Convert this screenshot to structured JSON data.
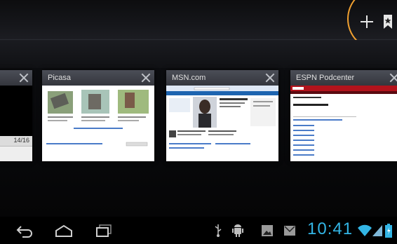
{
  "toolbar": {
    "new_tab_icon": "plus-icon",
    "bookmarks_icon": "bookmark-icon"
  },
  "tabs": [
    {
      "title": "",
      "page_number": "14/16"
    },
    {
      "title": "Picasa"
    },
    {
      "title": "MSN.com"
    },
    {
      "title": "ESPN Podcenter"
    }
  ],
  "status": {
    "time": "10:41",
    "icons": [
      "usb-icon",
      "android-debug-icon",
      "image-icon",
      "mail-icon",
      "wifi-icon",
      "signal-icon",
      "battery-icon"
    ]
  },
  "colors": {
    "accent": "#33b5e5",
    "highlight_ring": "#f0a030",
    "espn_red": "#b2131c",
    "msn_blue": "#1d64b0"
  }
}
